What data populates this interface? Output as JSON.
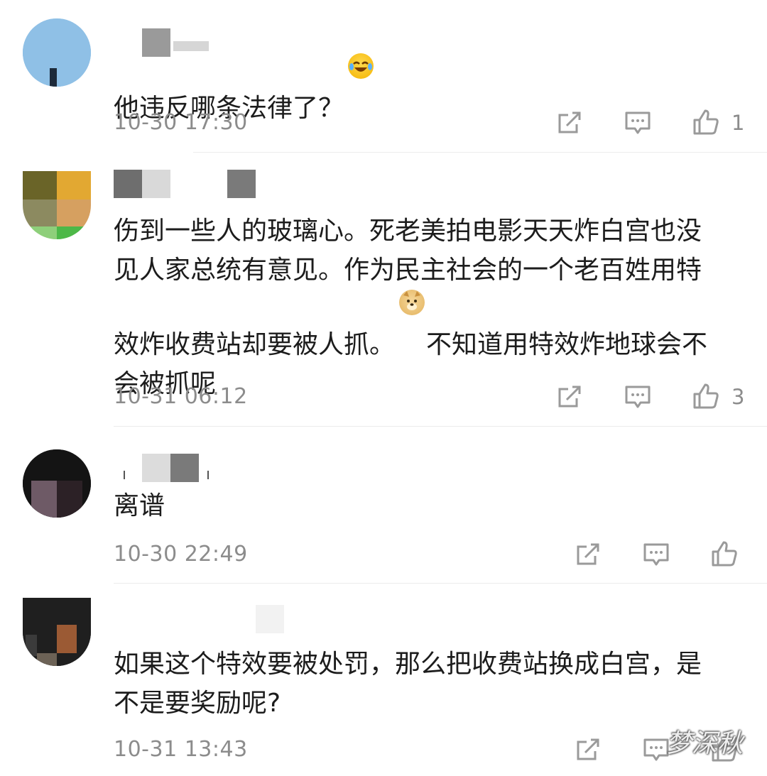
{
  "comments": [
    {
      "text": "他违反哪条法律了？",
      "emoji": "laughing-tears-emoji",
      "timestamp": "10-30 17:30",
      "likes": "1"
    },
    {
      "text": "伤到一些人的玻璃心。死老美拍电影天天炸白宫也没\n见人家总统有意见。作为民主社会的一个老百姓用特\n效炸收费站却要被人抓。",
      "emoji": "doge-emoji",
      "text_after_emoji": "不知道用特效炸地球会不\n会被抓呢",
      "timestamp": "10-31 06:12",
      "likes": "3"
    },
    {
      "text": "离谱",
      "timestamp": "10-30 22:49",
      "likes": ""
    },
    {
      "text": "如果这个特效要被处罚，那么把收费站换成白宫，是\n不是要奖励呢?",
      "timestamp": "10-31 13:43",
      "likes": ""
    }
  ],
  "watermark": "梦深秋",
  "colors": {
    "text": "#1c1c1c",
    "meta": "#8c8c8c",
    "divider": "#ececec",
    "icon": "#9a9a9a"
  }
}
